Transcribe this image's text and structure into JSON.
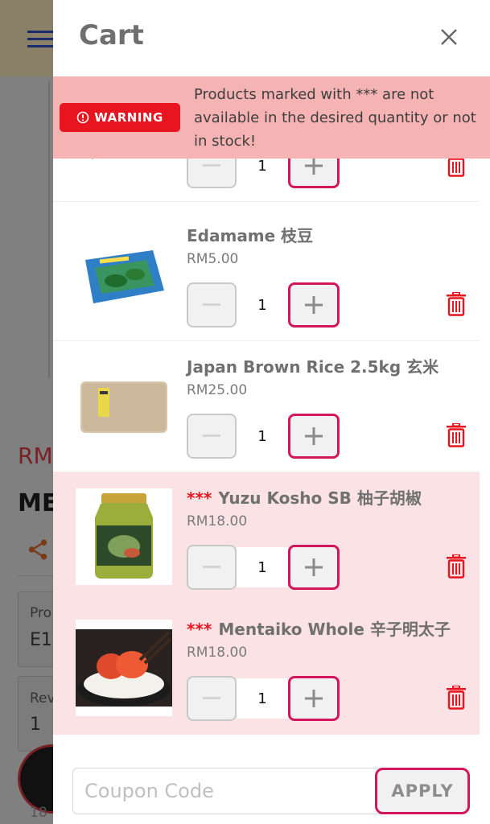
{
  "drawer": {
    "title": "Cart",
    "close_icon": "close-icon"
  },
  "warning": {
    "badge_label": "WARNING",
    "message": "Products marked with *** are not available in the desired quantity or not in stock!"
  },
  "items": [
    {
      "name": "",
      "price": "",
      "qty": "1",
      "unavailable": false,
      "marker": ""
    },
    {
      "name": "Edamame 枝豆",
      "price": "RM5.00",
      "qty": "1",
      "unavailable": false,
      "marker": ""
    },
    {
      "name": "Japan Brown Rice 2.5kg 玄米",
      "price": "RM25.00",
      "qty": "1",
      "unavailable": false,
      "marker": ""
    },
    {
      "name": "Yuzu Kosho SB 柚子胡椒",
      "price": "RM18.00",
      "qty": "1",
      "unavailable": true,
      "marker": "***"
    },
    {
      "name": "Mentaiko Whole 辛子明太子",
      "price": "RM18.00",
      "qty": "1",
      "unavailable": true,
      "marker": "***"
    }
  ],
  "coupon": {
    "placeholder": "Coupon Code",
    "apply_label": "APPLY"
  },
  "background": {
    "price_fragment": "RM",
    "title_fragment": "ME",
    "label1_fragment": "Pro",
    "value1_fragment": "E1",
    "label2_fragment": "Rev",
    "value2_fragment": "1",
    "bottom_fragment": "18"
  },
  "colors": {
    "accent": "#d3175c",
    "warning_red": "#e8141f",
    "warning_bg": "#f6b3b3",
    "unavailable_bg": "#fbe3e5"
  }
}
